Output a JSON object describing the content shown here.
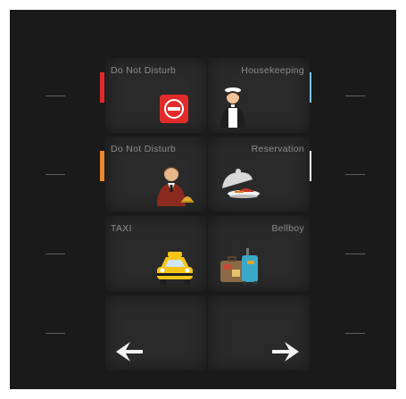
{
  "tiles": [
    {
      "label": "Do Not Disturb",
      "icon": "no-entry-icon"
    },
    {
      "label": "Housekeeping",
      "icon": "maid-icon"
    },
    {
      "label": "Do Not Disturb",
      "icon": "concierge-icon"
    },
    {
      "label": "Reservation",
      "icon": "cloche-icon"
    },
    {
      "label": "TAXI",
      "icon": "taxi-icon"
    },
    {
      "label": "Bellboy",
      "icon": "luggage-icon"
    },
    {
      "label": "",
      "icon": "arrow-left-icon"
    },
    {
      "label": "",
      "icon": "arrow-right-icon"
    }
  ],
  "indicators": {
    "row1_left": "#e02a2a",
    "row1_right": "#79c3e3",
    "row2_left": "#e8892e",
    "row2_right": "#ffffff"
  },
  "colors": {
    "panel": "#1b1a1a",
    "tile": "#2a2a2a",
    "label": "#8c8c8c"
  }
}
